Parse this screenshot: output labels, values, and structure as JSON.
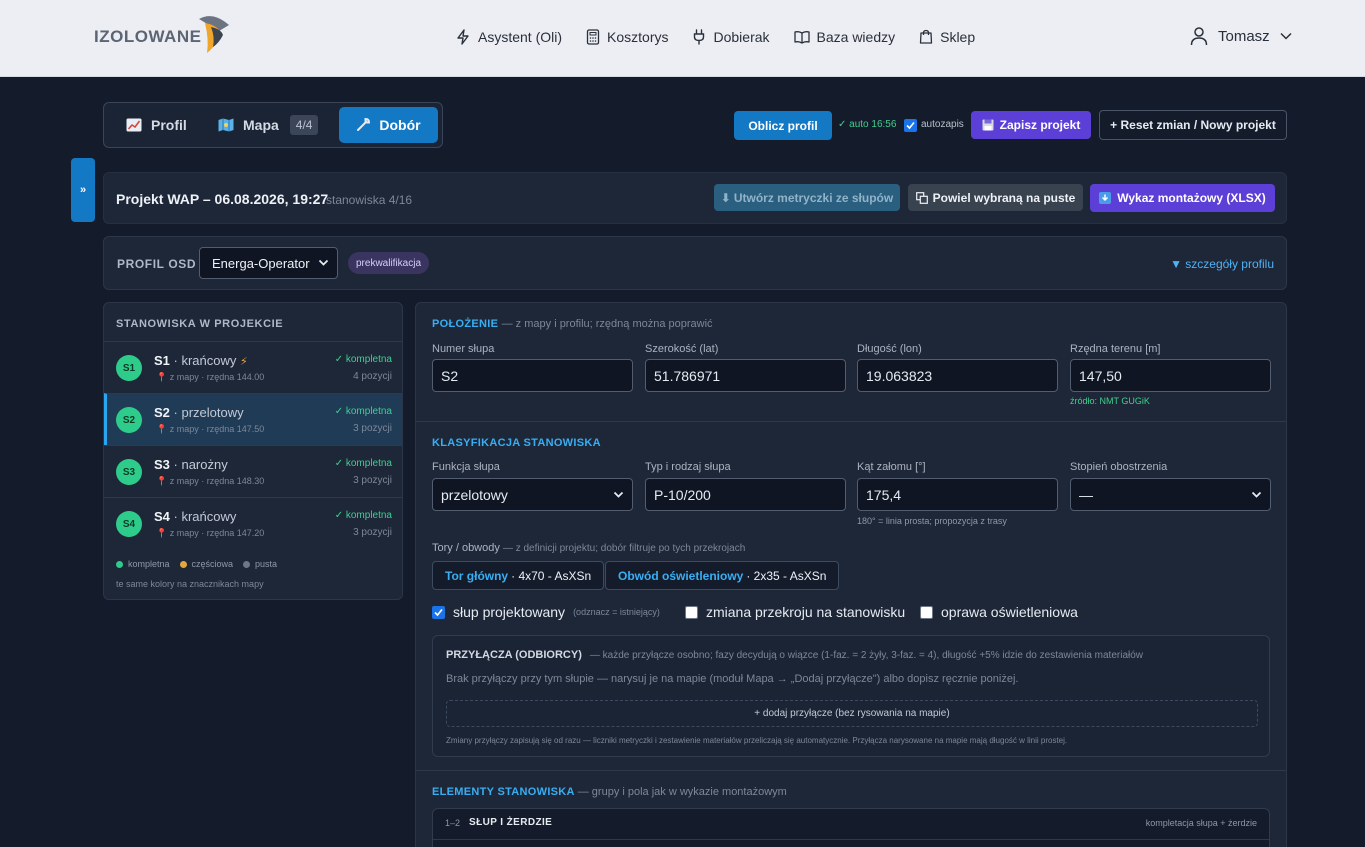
{
  "header": {
    "logo_text": "IZOLOWANE",
    "nav": [
      {
        "label": "Asystent (Oli)",
        "icon": "bolt-icon"
      },
      {
        "label": "Kosztorys",
        "icon": "calculator-icon"
      },
      {
        "label": "Dobierak",
        "icon": "plug-icon"
      },
      {
        "label": "Baza wiedzy",
        "icon": "book-icon"
      },
      {
        "label": "Sklep",
        "icon": "shop-icon"
      }
    ],
    "user_name": "Tomasz"
  },
  "mode_tabs": {
    "profil": "Profil",
    "mapa": "Mapa",
    "mapa_badge": "4/4",
    "dobor": "Dobór",
    "active": "dobor"
  },
  "toolbar": {
    "oblicz_label": "Oblicz profil",
    "auto_status": "✓ auto 16:56",
    "autozapis_label": "autozapis",
    "autozapis_checked": true,
    "zapisz_label": "Zapisz projekt",
    "reset_label": "+ Reset zmian / Nowy projekt"
  },
  "side_toggle": "»",
  "project": {
    "title": "Projekt WAP – 06.08.2026, 19:27",
    "subtitle": "stanowiska 4/16",
    "btn_metryczki": "Utwórz metryczki ze słupów",
    "btn_powiel": "Powiel wybraną na puste",
    "btn_wykaz": "Wykaz montażowy (XLSX)"
  },
  "osd": {
    "label": "PROFIL OSD",
    "selected": "Energa-Operator",
    "badge": "prekwalifikacja",
    "details_link": "▼ szczegóły profilu"
  },
  "stanowiska": {
    "header": "STANOWISKA W PROJEKCIE",
    "items": [
      {
        "badge": "S1",
        "name": "S1",
        "type": " · krańcowy",
        "sub": "z mapy · rzędna 144.00",
        "status": "✓ kompletna",
        "count": "4 pozycji",
        "flag": "⚡"
      },
      {
        "badge": "S2",
        "name": "S2",
        "type": " · przelotowy",
        "sub": "z mapy · rzędna 147.50",
        "status": "✓ kompletna",
        "count": "3 pozycji",
        "flag": ""
      },
      {
        "badge": "S3",
        "name": "S3",
        "type": " · narożny",
        "sub": "z mapy · rzędna 148.30",
        "status": "✓ kompletna",
        "count": "3 pozycji",
        "flag": ""
      },
      {
        "badge": "S4",
        "name": "S4",
        "type": " · krańcowy",
        "sub": "z mapy · rzędna 147.20",
        "status": "✓ kompletna",
        "count": "3 pozycji",
        "flag": ""
      }
    ],
    "active_index": 1,
    "legend": [
      {
        "label": "kompletna",
        "color": "#2ecc8a"
      },
      {
        "label": "częściowa",
        "color": "#e5a63a"
      },
      {
        "label": "pusta",
        "color": "#6e7787"
      }
    ],
    "legend_note": "te same kolory na znacznikach mapy"
  },
  "polozenie": {
    "heading": "POŁOŻENIE",
    "heading_note": "— z mapy i profilu; rzędną można poprawić",
    "numer_label": "Numer słupa",
    "numer_value": "S2",
    "lat_label": "Szerokość (lat)",
    "lat_value": "51.786971",
    "lon_label": "Długość (lon)",
    "lon_value": "19.063823",
    "rzedna_label": "Rzędna terenu [m]",
    "rzedna_value": "147,50",
    "rzedna_source": "źródło: NMT GUGiK"
  },
  "klasyfikacja": {
    "heading": "KLASYFIKACJA STANOWISKA",
    "funkcja_label": "Funkcja słupa",
    "funkcja_value": "przelotowy",
    "typ_label": "Typ i rodzaj słupa",
    "typ_value": "P-10/200",
    "kat_label": "Kąt załomu [°]",
    "kat_value": "175,4",
    "kat_hint": "180° = linia prosta; propozycja z trasy",
    "stopien_label": "Stopień obostrzenia",
    "stopien_value": "—",
    "tory_label": "Tory / obwody",
    "tory_note": "— z definicji projektu; dobór filtruje po tych przekrojach",
    "chips": [
      {
        "name": "Tor główny",
        "spec": "· 4x70 - AsXSn"
      },
      {
        "name": "Obwód oświetleniowy",
        "spec": "· 2x35 - AsXSn"
      }
    ],
    "cb_projektowany": "słup projektowany",
    "cb_projektowany_note": "(odznacz = istniejący)",
    "cb_projektowany_checked": true,
    "cb_zmiana": "zmiana przekroju na stanowisku",
    "cb_oprawa": "oprawa oświetleniowa"
  },
  "przylacza": {
    "heading": "PRZYŁĄCZA (ODBIORCY)",
    "heading_note": "— każde przyłącze osobno; fazy decydują o wiązce (1-faz. = 2 żyły, 3-faz. = 4), długość +5% idzie do zestawienia materiałów",
    "empty_text": "Brak przyłączy przy tym słupie — narysuj je na mapie (moduł Mapa → „Dodaj przyłącze\") albo dopisz ręcznie poniżej.",
    "add_label": "+ dodaj przyłącze (bez rysowania na mapie)",
    "note": "Zmiany przyłączy zapisują się od razu — liczniki metryczki i zestawienie materiałów przeliczają się automatycznie. Przyłącza narysowane na mapie mają długość w linii prostej."
  },
  "elementy": {
    "heading": "ELEMENTY STANOWISKA",
    "heading_note": "— grupy i pola jak w wykazie montażowym",
    "group_num": "1–2",
    "group_title": "SŁUP I ŻERDZIE",
    "group_right": "kompletacja słupa + żerdzie"
  }
}
